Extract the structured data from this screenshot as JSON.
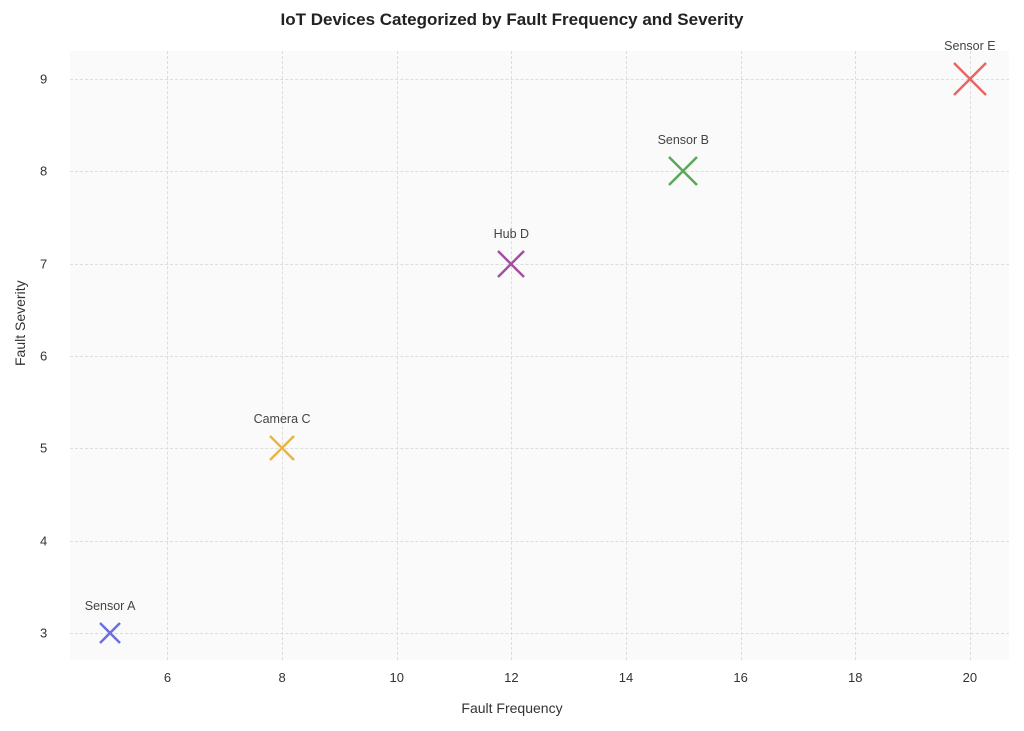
{
  "chart_data": {
    "type": "scatter",
    "title": "IoT Devices Categorized by Fault Frequency and Severity",
    "xlabel": "Fault Frequency",
    "ylabel": "Fault Severity",
    "x_ticks": [
      6,
      8,
      10,
      12,
      14,
      16,
      18,
      20
    ],
    "y_ticks": [
      3,
      4,
      5,
      6,
      7,
      8,
      9
    ],
    "xlim": [
      4.3,
      20.7
    ],
    "ylim": [
      2.7,
      9.3
    ],
    "series": [
      {
        "name": "Sensor A",
        "x": 5,
        "y": 3,
        "color": "#6b6fe0",
        "size": 24
      },
      {
        "name": "Camera C",
        "x": 8,
        "y": 5,
        "color": "#e8b545",
        "size": 28
      },
      {
        "name": "Hub D",
        "x": 12,
        "y": 7,
        "color": "#a050a0",
        "size": 30
      },
      {
        "name": "Sensor B",
        "x": 15,
        "y": 8,
        "color": "#5aa85a",
        "size": 32
      },
      {
        "name": "Sensor E",
        "x": 20,
        "y": 9,
        "color": "#e86565",
        "size": 36
      }
    ]
  }
}
